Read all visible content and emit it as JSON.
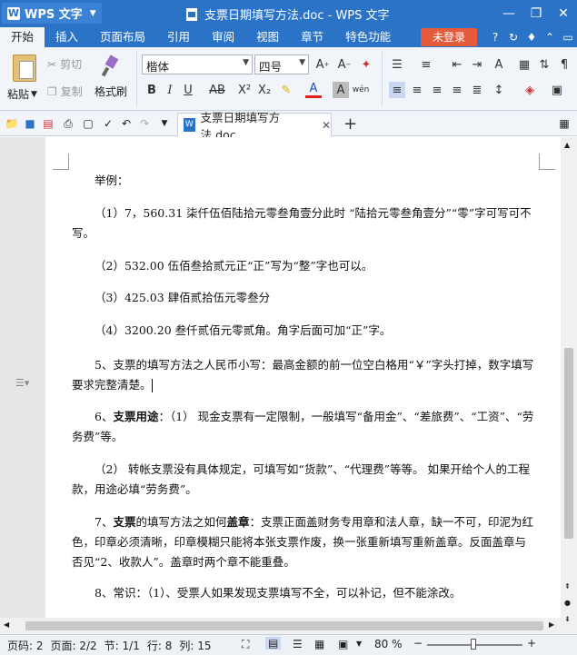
{
  "titlebar": {
    "app_name": "WPS 文字",
    "doc_title": "支票日期填写方法.doc - WPS 文字"
  },
  "menu": {
    "items": [
      "开始",
      "插入",
      "页面布局",
      "引用",
      "审阅",
      "视图",
      "章节",
      "特色功能"
    ],
    "login": "未登录"
  },
  "ribbon": {
    "paste": "粘贴",
    "cut": "剪切",
    "copy": "复制",
    "format_painter": "格式刷",
    "font_name": "楷体",
    "font_size": "四号"
  },
  "tabs": {
    "doc_tab": "支票日期填写方法.doc"
  },
  "document": {
    "p1": "举例：",
    "p2": "（1）7，560.31 柒仟伍佰陆拾元零叁角壹分此时 “陆拾元零叁角壹分”“零”字可写可不写。",
    "p3": "（2）532.00 伍佰叁拾贰元正“正”写为“整”字也可以。",
    "p4": "（3）425.03 肆佰贰拾伍元零叁分",
    "p5": "（4）3200.20 叁仟贰佰元零贰角。角字后面可加“正”字。",
    "p6": "5、支票的填写方法之人民币小写：最高金额的前一位空白格用“￥”字头打掉，数字填写要求完整清楚。",
    "p7_a": "6、",
    "p7_b": "支票用途",
    "p7_c": "：（1） 现金支票有一定限制，一般填写“备用金”、“差旅费”、“工资”、“劳务费”等。",
    "p8": "（2） 转帐支票没有具体规定，可填写如“货款”、“代理费”等等。 如果开给个人的工程款，用途必填“劳务费”。",
    "p9_a": "7、",
    "p9_b": "支票",
    "p9_c": "的填写方法之如何",
    "p9_d": "盖章",
    "p9_e": "：支票正面盖财务专用章和法人章，缺一不可，印泥为红色，印章必须清晰，印章模糊只能将本张支票作废，换一张重新填写重新盖章。反面盖章与否见“2、收款人”。盖章时两个章不能重叠。",
    "p10": "8、常识：（1）、受票人如果发现支票填写不全，可以补记，但不能涂改。"
  },
  "status": {
    "page_num": "页码: 2",
    "pages": "页面: 2/2",
    "section": "节: 1/1",
    "row": "行: 8",
    "col": "列: 15",
    "zoom": "80 %"
  }
}
